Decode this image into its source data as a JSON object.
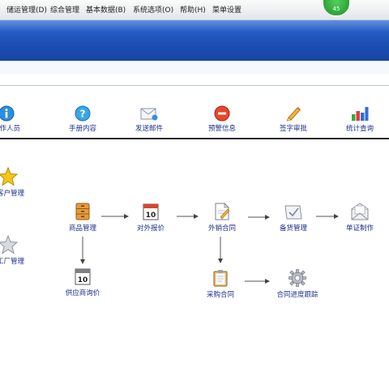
{
  "menu": {
    "items": [
      "储运管理(D)",
      "综合管理",
      "基本数据(B)",
      "系统选项(O)",
      "帮助(H)",
      "菜单设置"
    ]
  },
  "badge": {
    "text": "45"
  },
  "toolbar": {
    "items": [
      {
        "label": "操作人员",
        "icon": "info-icon"
      },
      {
        "label": "手册内容",
        "icon": "help-icon"
      },
      {
        "label": "发送邮件",
        "icon": "mail-icon"
      },
      {
        "label": "预警信息",
        "icon": "warning-icon"
      },
      {
        "label": "签字审批",
        "icon": "pencil-icon"
      },
      {
        "label": "统计查询",
        "icon": "bar-chart-icon"
      }
    ]
  },
  "sidebar": {
    "items": [
      {
        "label": "客户管理",
        "icon": "star-gold-icon"
      },
      {
        "label": "工厂管理",
        "icon": "star-gray-icon"
      }
    ]
  },
  "flow": {
    "nodes": {
      "product": "商品管理",
      "quote": "对外报价",
      "sales_contract": "外销合同",
      "stock": "备货管理",
      "documents": "单证制作",
      "supplier_price": "供应商询价",
      "purchase_contract": "采购合同",
      "contract_tracking": "合同进度跟踪"
    },
    "calendar_day": "10"
  },
  "colors": {
    "banner": "#1c50b4",
    "link_text": "#1b2f8a"
  }
}
